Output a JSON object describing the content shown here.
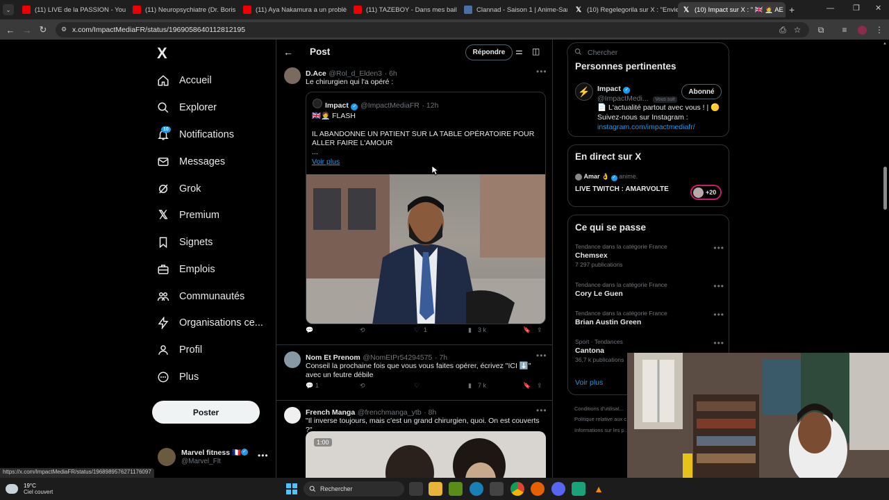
{
  "browser": {
    "tabs": [
      {
        "title": "(11) LIVE de la PASSION - YouTu",
        "icon": "youtube-icon"
      },
      {
        "title": "(11) Neuropsychiatre (Dr. Boris",
        "icon": "youtube-icon"
      },
      {
        "title": "(11) Aya Nakamura a un problè",
        "icon": "youtube-icon"
      },
      {
        "title": "(11) TAZEBOY - Dans mes bails",
        "icon": "youtube-icon"
      },
      {
        "title": "Clannad - Saison 1 | Anime-Sam",
        "icon": "anime-icon"
      },
      {
        "title": "(10) Regelegorila sur X : \"Envie",
        "icon": "x-icon"
      },
      {
        "title": "(10) Impact sur X : \" 🇬🇧 🧑‍⚕️ AE",
        "icon": "x-icon"
      }
    ],
    "url": "x.com/ImpactMediaFR/status/1969058640112812195",
    "status_url": "https://x.com/ImpactMediaFR/status/1968989576271176097"
  },
  "nav": {
    "logo": "X",
    "items": [
      {
        "label": "Accueil",
        "icon": "home-icon"
      },
      {
        "label": "Explorer",
        "icon": "search-icon"
      },
      {
        "label": "Notifications",
        "icon": "bell-icon"
      },
      {
        "label": "Messages",
        "icon": "mail-icon"
      },
      {
        "label": "Grok",
        "icon": "grok-icon"
      },
      {
        "label": "Premium",
        "icon": "x-icon"
      },
      {
        "label": "Signets",
        "icon": "bookmark-icon"
      },
      {
        "label": "Emplois",
        "icon": "briefcase-icon"
      },
      {
        "label": "Communautés",
        "icon": "people-icon"
      },
      {
        "label": "Organisations ce...",
        "icon": "bolt-icon"
      },
      {
        "label": "Profil",
        "icon": "person-icon"
      },
      {
        "label": "Plus",
        "icon": "more-circle-icon"
      }
    ],
    "notif_badge": "10",
    "post_button": "Poster",
    "account": {
      "name": "Marvel fitness 🇫🇷",
      "handle": "@Marvel_Flt"
    }
  },
  "header": {
    "title": "Post",
    "reply_button": "Répondre"
  },
  "posts": [
    {
      "name": "D.Ace",
      "handle": "@Rol_d_Elden3",
      "time": "· 6h",
      "text": "Le chirurgien qui l'a opéré :",
      "quote": {
        "name": "Impact",
        "handle": "@ImpactMediaFR",
        "time": "· 12h",
        "line1": "🇬🇧🧑‍⚕️ FLASH",
        "line2": "IL ABANDONNE UN PATIENT SUR LA TABLE OPÉRATOIRE POUR ALLER FAIRE L'AMOUR",
        "line3": "...",
        "more": "Voir plus"
      },
      "stats": {
        "reply": "",
        "repost": "",
        "like": "1",
        "views": "3 k"
      }
    },
    {
      "name": "Nom Et Prenom",
      "handle": "@NomEtPr54294575",
      "time": "· 7h",
      "text": "Conseil la prochaine fois que vous vous faites opérer, écrivez \"ICI ⬇️\" avec un feutre débile",
      "stats": {
        "reply": "1",
        "repost": "",
        "like": "",
        "views": "7 k"
      }
    },
    {
      "name": "French Manga",
      "handle": "@frenchmanga_ytb",
      "time": "· 8h",
      "text": "\"Il inverse toujours, mais c'est un grand chirurgien, quoi. On est couverts ?\"",
      "video_time": "1:00"
    }
  ],
  "search": {
    "placeholder": "Chercher"
  },
  "relevant": {
    "title": "Personnes pertinentes",
    "name": "Impact",
    "handle": "@ImpactMedi...",
    "follows_you": "Vous suit",
    "follow_button": "Abonné",
    "bio1": "📄 L'actualité partout avec vous ! | 🟡",
    "bio2": "Suivez-nous sur Instagram :",
    "bio_link": "instagram.com/impactmediafr/"
  },
  "live": {
    "title": "En direct sur X",
    "host": "Amar 👌",
    "host_sub": "anime.",
    "stream_title": "LIVE TWITCH : AMARVOLTE",
    "viewers": "+20"
  },
  "trends": {
    "title": "Ce qui se passe",
    "items": [
      {
        "cat": "Tendance dans la catégorie France",
        "name": "Chemsex",
        "count": "7 297 publications"
      },
      {
        "cat": "Tendance dans la catégorie France",
        "name": "Cory Le Guen",
        "count": ""
      },
      {
        "cat": "Tendance dans la catégorie France",
        "name": "Brian Austin Green",
        "count": ""
      },
      {
        "cat": "Sport · Tendances",
        "name": "Cantona",
        "count": "36,7 k publications"
      }
    ],
    "more": "Voir plus"
  },
  "footer_links": [
    "Conditions d'utilisat...",
    "Politique relative aux c...",
    "Informations sur les p..."
  ],
  "taskbar": {
    "weather_temp": "19°C",
    "weather_desc": "Ciel couvert",
    "search_label": "Rechercher"
  }
}
